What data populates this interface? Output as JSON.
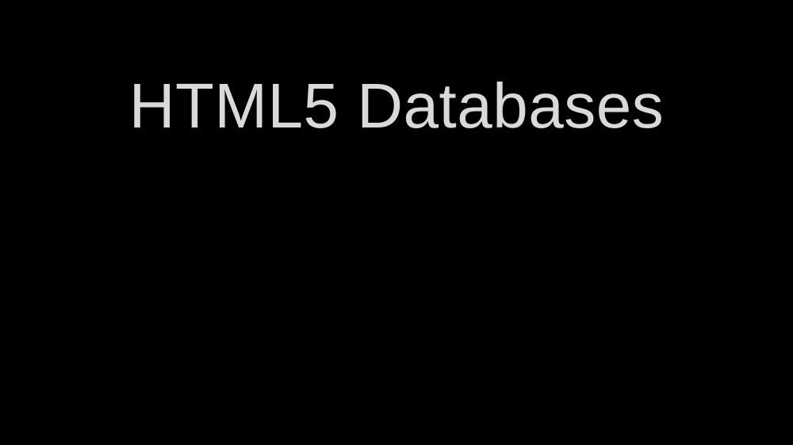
{
  "slide": {
    "title": "HTML5 Databases",
    "colors": {
      "background": "#000000",
      "title_text": "#d9d9d9"
    }
  }
}
